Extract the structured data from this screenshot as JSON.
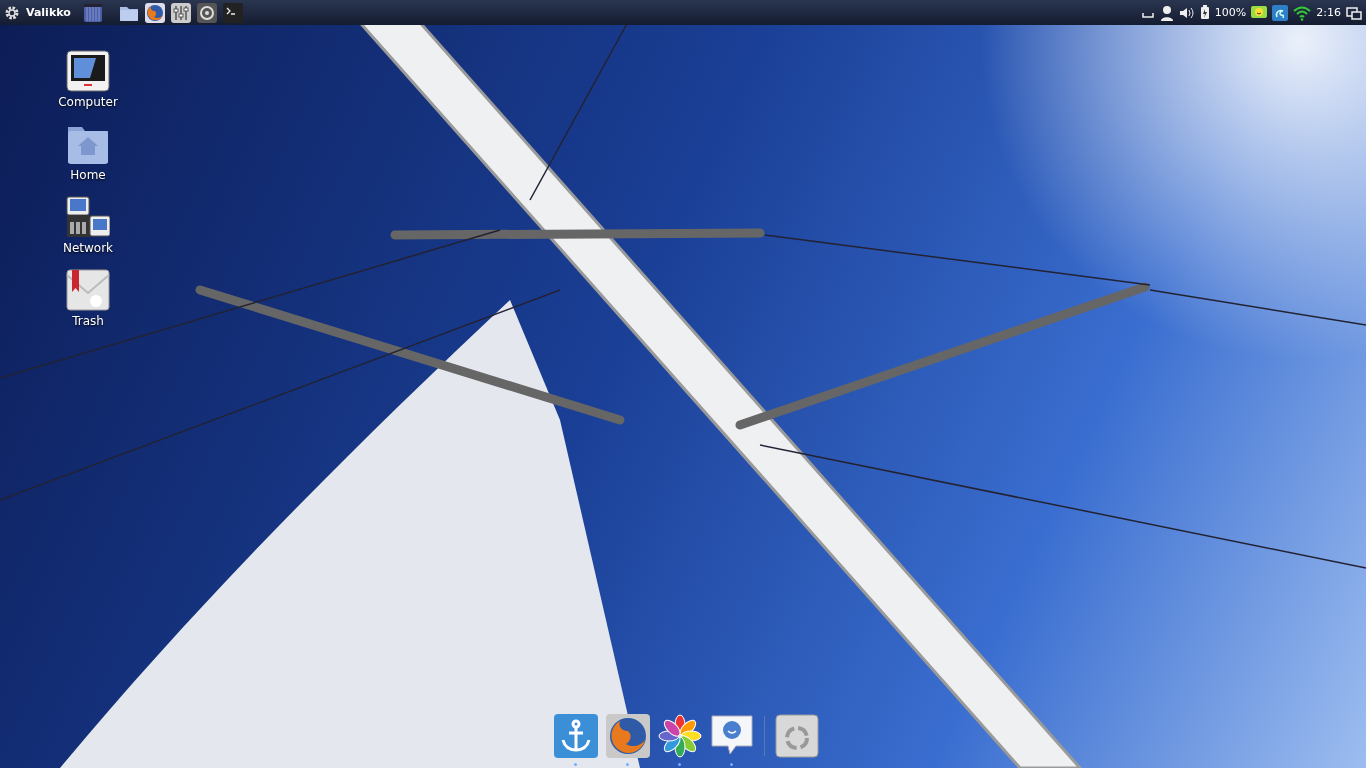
{
  "top_panel": {
    "menu_label": "Valikko",
    "launchers": [
      {
        "kind": "workspace"
      },
      {
        "kind": "folder"
      },
      {
        "kind": "browser"
      },
      {
        "kind": "mixer"
      },
      {
        "kind": "disk"
      },
      {
        "kind": "terminal"
      }
    ],
    "tray": {
      "battery_text": "100%",
      "clock": "2:16"
    }
  },
  "desktop_icons": [
    {
      "kind": "computer",
      "label": "Computer"
    },
    {
      "kind": "home",
      "label": "Home"
    },
    {
      "kind": "network",
      "label": "Network"
    },
    {
      "kind": "trash",
      "label": "Trash"
    }
  ],
  "dock": [
    {
      "kind": "anchor",
      "running": true
    },
    {
      "kind": "browser",
      "running": true
    },
    {
      "kind": "flower",
      "running": true
    },
    {
      "kind": "chat",
      "running": true
    },
    {
      "kind": "recycle",
      "running": false
    }
  ]
}
